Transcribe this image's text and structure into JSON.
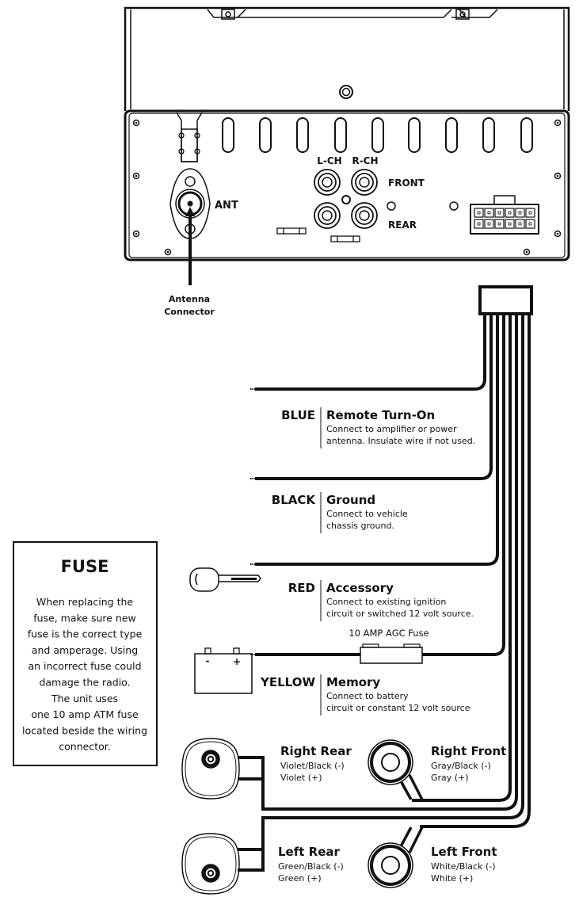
{
  "head_unit": {
    "ant_label": "ANT",
    "lch_label": "L-CH",
    "rch_label": "R-CH",
    "front_label": "FRONT",
    "rear_label": "REAR",
    "antenna_caption_line1": "Antenna",
    "antenna_caption_line2": "Connector"
  },
  "wires": [
    {
      "color": "BLUE",
      "title": "Remote Turn-On",
      "line1": "Connect to amplifier or power",
      "line2": "antenna. Insulate wire if not used."
    },
    {
      "color": "BLACK",
      "title": "Ground",
      "line1": "Connect to vehicle",
      "line2": "chassis ground."
    },
    {
      "color": "RED",
      "title": "Accessory",
      "line1": "Connect to existing ignition",
      "line2": "circuit or switched 12 volt source."
    },
    {
      "color": "YELLOW",
      "title": "Memory",
      "line1": "Connect to battery",
      "line2": "circuit or constant 12 volt source"
    }
  ],
  "inline_fuse_label": "10 AMP  AGC Fuse",
  "battery": {
    "minus": "-",
    "plus": "+"
  },
  "speakers": [
    {
      "title": "Right Rear",
      "neg": "Violet/Black (-)",
      "pos": "Violet (+)"
    },
    {
      "title": "Right Front",
      "neg": "Gray/Black (-)",
      "pos": "Gray (+)"
    },
    {
      "title": "Left Rear",
      "neg": "Green/Black (-)",
      "pos": "Green (+)"
    },
    {
      "title": "Left Front",
      "neg": "White/Black (-)",
      "pos": "White (+)"
    }
  ],
  "fuse_box": {
    "title": "FUSE",
    "lines": [
      "When replacing the",
      "fuse, make sure new",
      "fuse is the correct type",
      "and amperage. Using",
      "an incorrect fuse could",
      "damage the radio.",
      "The unit uses",
      "one 10 amp ATM fuse",
      "located beside the wiring",
      "connector."
    ]
  }
}
